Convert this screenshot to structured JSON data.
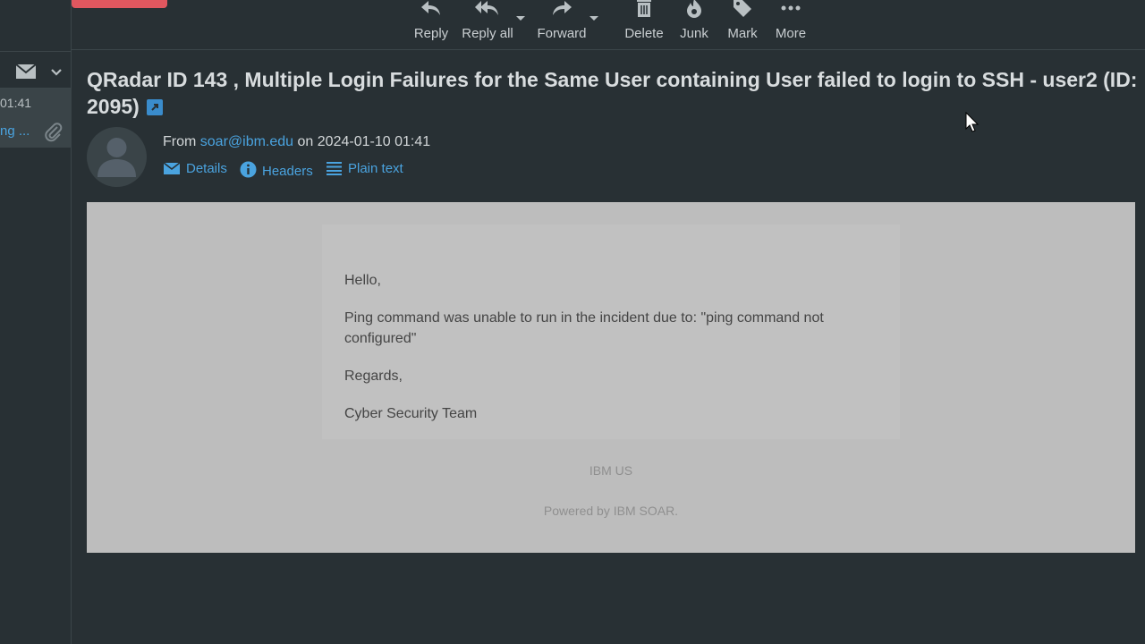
{
  "toolbar": {
    "reply": "Reply",
    "reply_all": "Reply all",
    "forward": "Forward",
    "delete": "Delete",
    "junk": "Junk",
    "mark": "Mark",
    "more": "More"
  },
  "list": {
    "time": "01:41",
    "subject_snippet": "ng ..."
  },
  "message": {
    "subject": "QRadar ID 143 , Multiple Login Failures for the Same User containing User failed to login to SSH - user2 (ID: 2095)",
    "from_label": "From",
    "from_email": "soar@ibm.edu",
    "date_prefix": "on",
    "date": "2024-01-10 01:41",
    "links": {
      "details": "Details",
      "headers": "Headers",
      "plain_text": "Plain text"
    },
    "body": {
      "greeting": "Hello,",
      "text": "Ping command was unable to run in the incident due to: \"ping command not configured\"",
      "regards": "Regards,",
      "signature": "Cyber Security Team"
    },
    "footer": {
      "company": "IBM US",
      "powered": "Powered by IBM SOAR."
    }
  },
  "colors": {
    "background": "#283034",
    "link": "#4aa3df",
    "accent_pill": "#e0575f",
    "message_bg": "#bdbdbd"
  }
}
